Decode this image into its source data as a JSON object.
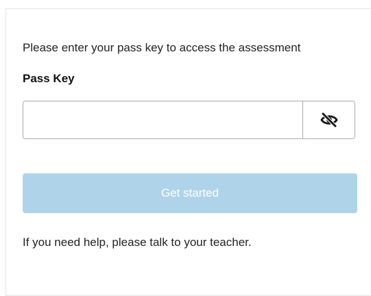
{
  "instructions": "Please enter your pass key to access the assessment",
  "pass_key": {
    "label": "Pass Key",
    "value": "",
    "placeholder": "",
    "toggle_icon": "eye-slash-icon"
  },
  "start_button": {
    "label": "Get started",
    "background": "#afd4ea",
    "text_color": "#ffffff"
  },
  "help_text": "If you need help, please talk to your teacher."
}
